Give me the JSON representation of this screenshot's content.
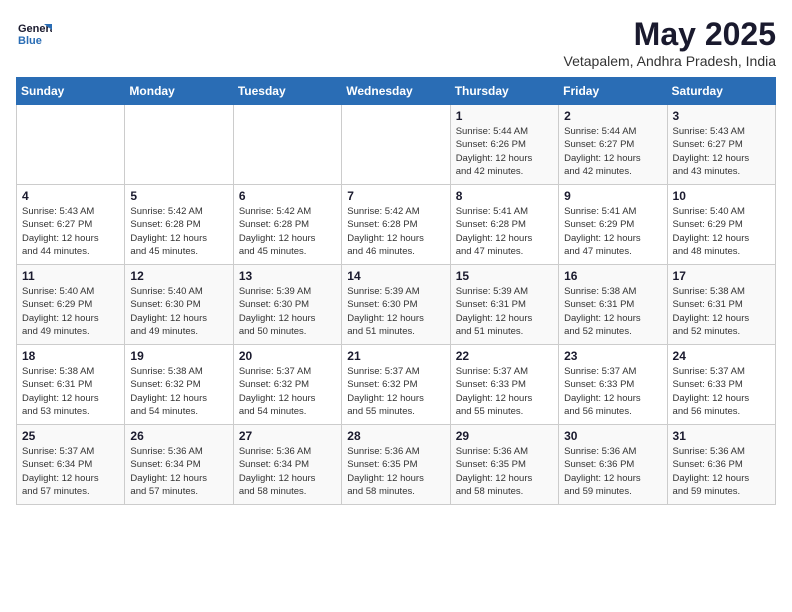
{
  "header": {
    "logo_line1": "General",
    "logo_line2": "Blue",
    "month_title": "May 2025",
    "subtitle": "Vetapalem, Andhra Pradesh, India"
  },
  "weekdays": [
    "Sunday",
    "Monday",
    "Tuesday",
    "Wednesday",
    "Thursday",
    "Friday",
    "Saturday"
  ],
  "weeks": [
    [
      {
        "day": "",
        "info": ""
      },
      {
        "day": "",
        "info": ""
      },
      {
        "day": "",
        "info": ""
      },
      {
        "day": "",
        "info": ""
      },
      {
        "day": "1",
        "info": "Sunrise: 5:44 AM\nSunset: 6:26 PM\nDaylight: 12 hours\nand 42 minutes."
      },
      {
        "day": "2",
        "info": "Sunrise: 5:44 AM\nSunset: 6:27 PM\nDaylight: 12 hours\nand 42 minutes."
      },
      {
        "day": "3",
        "info": "Sunrise: 5:43 AM\nSunset: 6:27 PM\nDaylight: 12 hours\nand 43 minutes."
      }
    ],
    [
      {
        "day": "4",
        "info": "Sunrise: 5:43 AM\nSunset: 6:27 PM\nDaylight: 12 hours\nand 44 minutes."
      },
      {
        "day": "5",
        "info": "Sunrise: 5:42 AM\nSunset: 6:28 PM\nDaylight: 12 hours\nand 45 minutes."
      },
      {
        "day": "6",
        "info": "Sunrise: 5:42 AM\nSunset: 6:28 PM\nDaylight: 12 hours\nand 45 minutes."
      },
      {
        "day": "7",
        "info": "Sunrise: 5:42 AM\nSunset: 6:28 PM\nDaylight: 12 hours\nand 46 minutes."
      },
      {
        "day": "8",
        "info": "Sunrise: 5:41 AM\nSunset: 6:28 PM\nDaylight: 12 hours\nand 47 minutes."
      },
      {
        "day": "9",
        "info": "Sunrise: 5:41 AM\nSunset: 6:29 PM\nDaylight: 12 hours\nand 47 minutes."
      },
      {
        "day": "10",
        "info": "Sunrise: 5:40 AM\nSunset: 6:29 PM\nDaylight: 12 hours\nand 48 minutes."
      }
    ],
    [
      {
        "day": "11",
        "info": "Sunrise: 5:40 AM\nSunset: 6:29 PM\nDaylight: 12 hours\nand 49 minutes."
      },
      {
        "day": "12",
        "info": "Sunrise: 5:40 AM\nSunset: 6:30 PM\nDaylight: 12 hours\nand 49 minutes."
      },
      {
        "day": "13",
        "info": "Sunrise: 5:39 AM\nSunset: 6:30 PM\nDaylight: 12 hours\nand 50 minutes."
      },
      {
        "day": "14",
        "info": "Sunrise: 5:39 AM\nSunset: 6:30 PM\nDaylight: 12 hours\nand 51 minutes."
      },
      {
        "day": "15",
        "info": "Sunrise: 5:39 AM\nSunset: 6:31 PM\nDaylight: 12 hours\nand 51 minutes."
      },
      {
        "day": "16",
        "info": "Sunrise: 5:38 AM\nSunset: 6:31 PM\nDaylight: 12 hours\nand 52 minutes."
      },
      {
        "day": "17",
        "info": "Sunrise: 5:38 AM\nSunset: 6:31 PM\nDaylight: 12 hours\nand 52 minutes."
      }
    ],
    [
      {
        "day": "18",
        "info": "Sunrise: 5:38 AM\nSunset: 6:31 PM\nDaylight: 12 hours\nand 53 minutes."
      },
      {
        "day": "19",
        "info": "Sunrise: 5:38 AM\nSunset: 6:32 PM\nDaylight: 12 hours\nand 54 minutes."
      },
      {
        "day": "20",
        "info": "Sunrise: 5:37 AM\nSunset: 6:32 PM\nDaylight: 12 hours\nand 54 minutes."
      },
      {
        "day": "21",
        "info": "Sunrise: 5:37 AM\nSunset: 6:32 PM\nDaylight: 12 hours\nand 55 minutes."
      },
      {
        "day": "22",
        "info": "Sunrise: 5:37 AM\nSunset: 6:33 PM\nDaylight: 12 hours\nand 55 minutes."
      },
      {
        "day": "23",
        "info": "Sunrise: 5:37 AM\nSunset: 6:33 PM\nDaylight: 12 hours\nand 56 minutes."
      },
      {
        "day": "24",
        "info": "Sunrise: 5:37 AM\nSunset: 6:33 PM\nDaylight: 12 hours\nand 56 minutes."
      }
    ],
    [
      {
        "day": "25",
        "info": "Sunrise: 5:37 AM\nSunset: 6:34 PM\nDaylight: 12 hours\nand 57 minutes."
      },
      {
        "day": "26",
        "info": "Sunrise: 5:36 AM\nSunset: 6:34 PM\nDaylight: 12 hours\nand 57 minutes."
      },
      {
        "day": "27",
        "info": "Sunrise: 5:36 AM\nSunset: 6:34 PM\nDaylight: 12 hours\nand 58 minutes."
      },
      {
        "day": "28",
        "info": "Sunrise: 5:36 AM\nSunset: 6:35 PM\nDaylight: 12 hours\nand 58 minutes."
      },
      {
        "day": "29",
        "info": "Sunrise: 5:36 AM\nSunset: 6:35 PM\nDaylight: 12 hours\nand 58 minutes."
      },
      {
        "day": "30",
        "info": "Sunrise: 5:36 AM\nSunset: 6:36 PM\nDaylight: 12 hours\nand 59 minutes."
      },
      {
        "day": "31",
        "info": "Sunrise: 5:36 AM\nSunset: 6:36 PM\nDaylight: 12 hours\nand 59 minutes."
      }
    ]
  ]
}
